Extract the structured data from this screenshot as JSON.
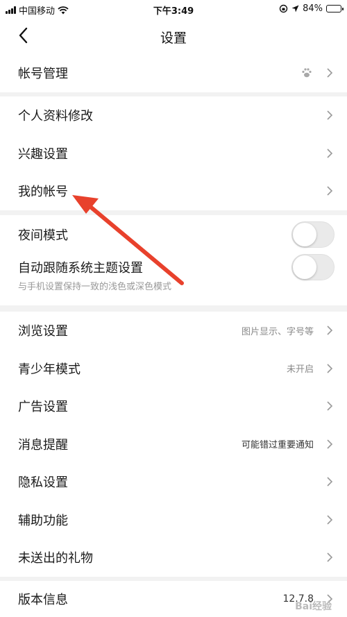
{
  "status_bar": {
    "carrier": "中国移动",
    "time": "下午3:49",
    "battery": "84%",
    "battery_level": 0.84
  },
  "nav": {
    "title": "设置"
  },
  "groups": [
    {
      "items": [
        {
          "label": "帐号管理"
        }
      ]
    },
    {
      "items": [
        {
          "label": "个人资料修改"
        },
        {
          "label": "兴趣设置"
        },
        {
          "label": "我的帐号"
        }
      ]
    },
    {
      "items": [
        {
          "label": "夜间模式",
          "toggle": false
        },
        {
          "label": "自动跟随系统主题设置",
          "sub": "与手机设置保持一致的浅色或深色模式",
          "toggle": false
        }
      ]
    },
    {
      "items": [
        {
          "label": "浏览设置",
          "value": "图片显示、字号等"
        },
        {
          "label": "青少年模式",
          "value": "未开启"
        },
        {
          "label": "广告设置"
        },
        {
          "label": "消息提醒",
          "value": "可能错过重要通知"
        },
        {
          "label": "隐私设置"
        },
        {
          "label": "辅助功能"
        },
        {
          "label": "未送出的礼物"
        }
      ]
    },
    {
      "items": [
        {
          "label": "版本信息",
          "value": "12.7.8"
        }
      ]
    }
  ],
  "watermark": "Bai经验",
  "colors": {
    "arrow": "#e8412c",
    "background": "#f2f2f2",
    "toggle_off": "#eaeaea"
  }
}
